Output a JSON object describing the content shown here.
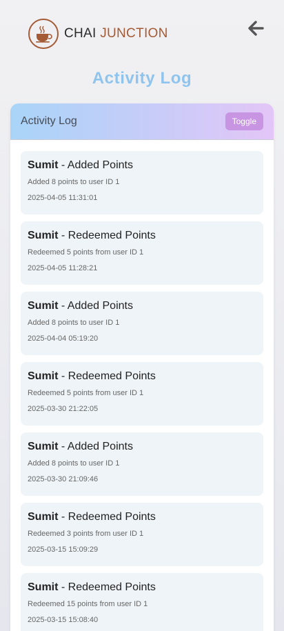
{
  "header": {
    "logo_word1": "CHAI",
    "logo_word2": "JUNCTION",
    "back_icon": "arrow-left-icon"
  },
  "page_title": "Activity Log",
  "card": {
    "title": "Activity Log",
    "toggle_label": "Toggle"
  },
  "activities": [
    {
      "user": "Sumit",
      "sep": " - ",
      "action": "Added Points",
      "description": "Added 8 points to user ID 1",
      "timestamp": "2025-04-05 11:31:01"
    },
    {
      "user": "Sumit",
      "sep": " - ",
      "action": "Redeemed Points",
      "description": "Redeemed 5 points from user ID 1",
      "timestamp": "2025-04-05 11:28:21"
    },
    {
      "user": "Sumit",
      "sep": " - ",
      "action": "Added Points",
      "description": "Added 8 points to user ID 1",
      "timestamp": "2025-04-04 05:19:20"
    },
    {
      "user": "Sumit",
      "sep": " - ",
      "action": "Redeemed Points",
      "description": "Redeemed 5 points from user ID 1",
      "timestamp": "2025-03-30 21:22:05"
    },
    {
      "user": "Sumit",
      "sep": " - ",
      "action": "Added Points",
      "description": "Added 8 points to user ID 1",
      "timestamp": "2025-03-30 21:09:46"
    },
    {
      "user": "Sumit",
      "sep": " - ",
      "action": "Redeemed Points",
      "description": "Redeemed 3 points from user ID 1",
      "timestamp": "2025-03-15 15:09:29"
    },
    {
      "user": "Sumit",
      "sep": " - ",
      "action": "Redeemed Points",
      "description": "Redeemed 15 points from user ID 1",
      "timestamp": "2025-03-15 15:08:40"
    }
  ],
  "colors": {
    "brand": "#a35a35",
    "title": "#8fc4ee",
    "toggle": "#c895e3",
    "item_bg": "#eef4f8"
  }
}
